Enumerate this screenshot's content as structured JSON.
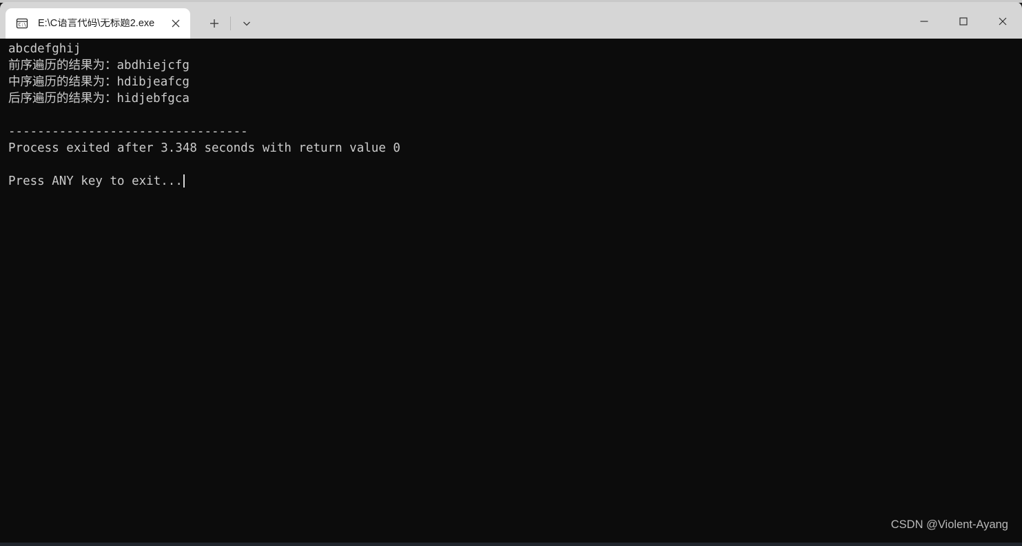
{
  "window": {
    "tab": {
      "icon": "console-cmd-icon",
      "title": "E:\\C语言代码\\无标题2.exe",
      "close_icon": "close-icon"
    },
    "new_tab_icon": "plus-icon",
    "tab_dropdown_icon": "chevron-down-icon",
    "caption": {
      "minimize_icon": "minimize-icon",
      "maximize_icon": "maximize-icon",
      "close_icon": "close-icon"
    }
  },
  "console": {
    "lines": [
      "abcdefghij",
      "前序遍历的结果为：abdhiejcfg",
      "中序遍历的结果为：hdibjeafcg",
      "后序遍历的结果为：hidjebfgca",
      "",
      "---------------------------------",
      "Process exited after 3.348 seconds with return value 0",
      "",
      "Press ANY key to exit..."
    ],
    "background_color": "#0c0c0c",
    "text_color": "#cccccc",
    "cursor_visible": true
  },
  "watermark": {
    "text": "CSDN @Violent-Ayang"
  }
}
